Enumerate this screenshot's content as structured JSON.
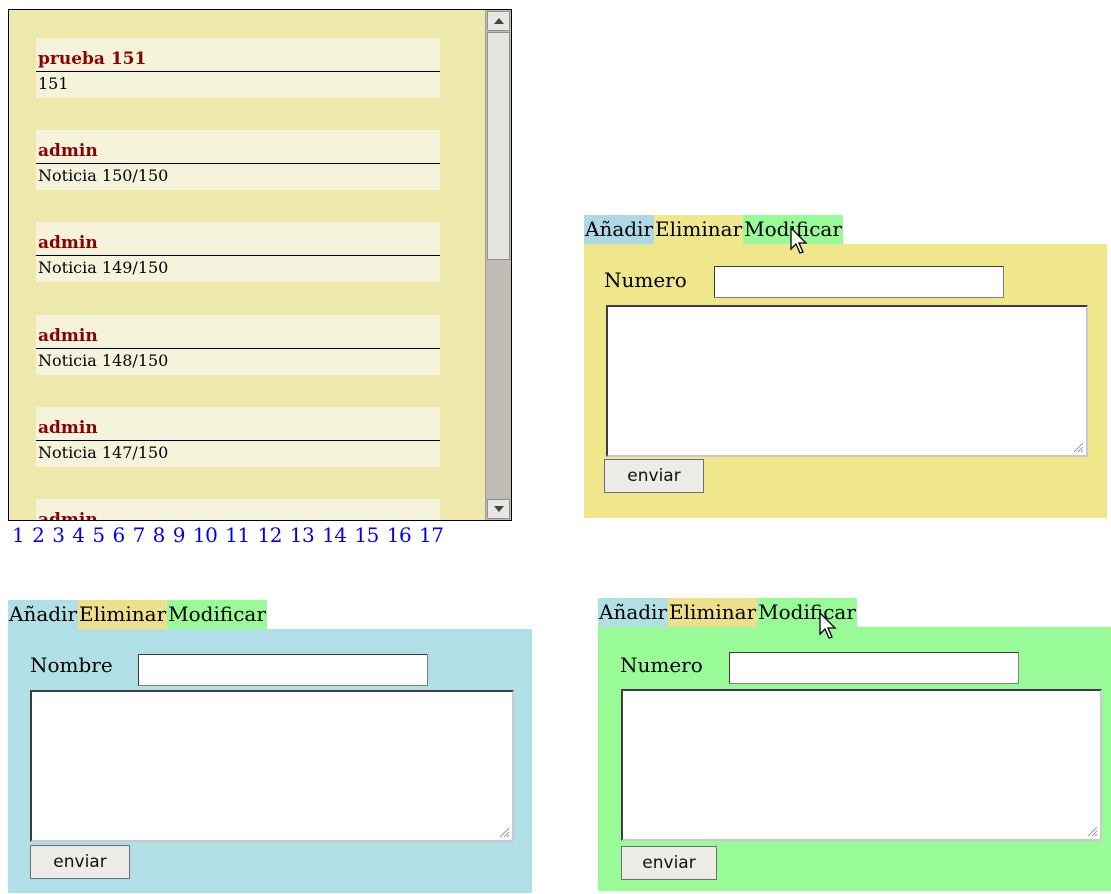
{
  "news": [
    {
      "author": "prueba 151",
      "text": "151"
    },
    {
      "author": "admin",
      "text": "Noticia 150/150"
    },
    {
      "author": "admin",
      "text": "Noticia 149/150"
    },
    {
      "author": "admin",
      "text": "Noticia 148/150"
    },
    {
      "author": "admin",
      "text": "Noticia 147/150"
    },
    {
      "author": "admin",
      "text": ""
    }
  ],
  "pagination": [
    "1",
    "2",
    "3",
    "4",
    "5",
    "6",
    "7",
    "8",
    "9",
    "10",
    "11",
    "12",
    "13",
    "14",
    "15",
    "16",
    "17"
  ],
  "tabs": {
    "add": "Añadir",
    "delete": "Eliminar",
    "modify": "Modificar"
  },
  "forms": {
    "modify_top": {
      "label": "Numero",
      "value": "",
      "message": "",
      "submit": "enviar",
      "background": "#f0e68c"
    },
    "add": {
      "label": "Nombre",
      "value": "",
      "message": "",
      "submit": "enviar",
      "background": "#b0dfe5"
    },
    "modify_bottom": {
      "label": "Numero",
      "value": "",
      "message": "",
      "submit": "enviar",
      "background": "#98fb98"
    }
  },
  "colors": {
    "panel_bg": "#eee8aa",
    "item_bg": "#f5f3dc",
    "author_color": "#8b0000",
    "link_color": "#0000ee",
    "tab_add": "#add8e6",
    "tab_delete": "#eee08a",
    "tab_modify": "#98fb98"
  },
  "icons": {
    "cursor": "arrow-pointer-icon",
    "resize": "resize-grip-icon"
  }
}
